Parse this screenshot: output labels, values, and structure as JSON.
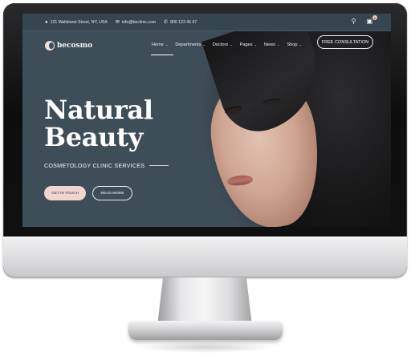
{
  "topbar": {
    "address": "121 Wallstreet Street, NY, USA",
    "email": "info@beclinic.com",
    "phone": "800 123 45 67",
    "cart_count": "0"
  },
  "brand": {
    "logo_text": "becosmo"
  },
  "nav": {
    "items": [
      {
        "label": "Home",
        "active": true
      },
      {
        "label": "Departments"
      },
      {
        "label": "Doctors"
      },
      {
        "label": "Pages"
      },
      {
        "label": "News"
      },
      {
        "label": "Shop"
      }
    ],
    "cta": "FREE CONSULTATION"
  },
  "hero": {
    "title_line1": "Natural",
    "title_line2": "Beauty",
    "subtitle": "COSMETOLOGY CLINIC SERVICES",
    "primary_button": "GET IN TOUCH",
    "secondary_button": "READ MORE"
  },
  "icons": {
    "location": "map-pin-icon",
    "email": "envelope-icon",
    "phone": "phone-icon",
    "search": "search-icon",
    "cart": "cart-icon",
    "chevron": "chevron-down-icon"
  },
  "colors": {
    "hero_bg": "#3e4e58",
    "accent_pink": "#f0d6cf"
  }
}
